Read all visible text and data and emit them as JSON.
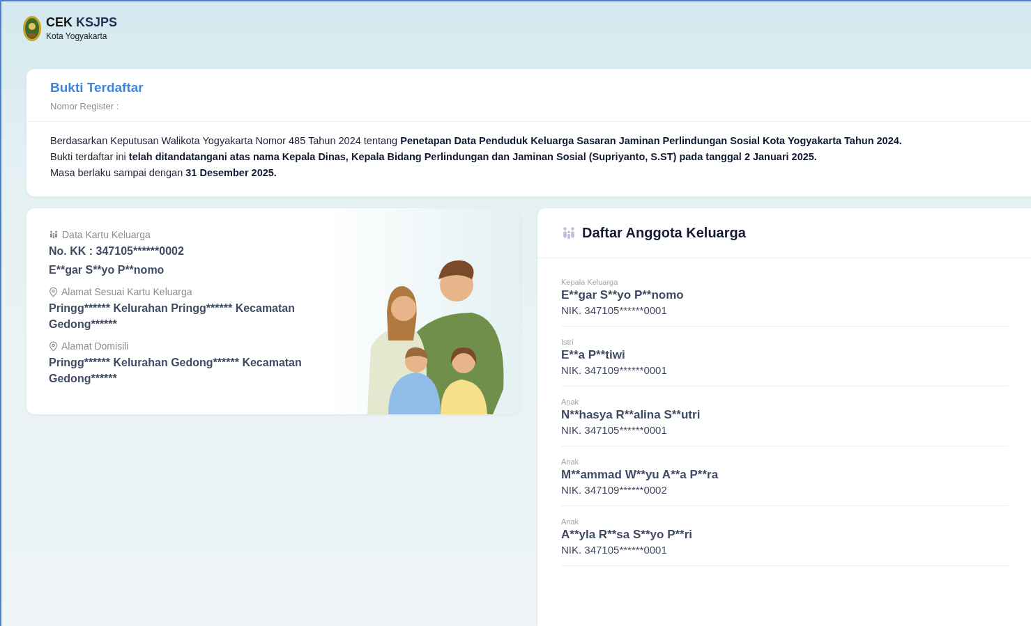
{
  "header": {
    "title_primary": "CEK",
    "title_secondary": "KSJPS",
    "subtitle": "Kota Yogyakarta"
  },
  "proof_card": {
    "title": "Bukti Terdaftar",
    "register_label": "Nomor Register :",
    "lines": [
      "Berdasarkan Keputusan Walikota Yogyakarta Nomor 485 Tahun 2024 tentang **Penetapan Data Penduduk Keluarga Sasaran Jaminan Perlindungan Sosial Kota Yogyakarta Tahun 2024.**",
      "Bukti terdaftar ini **telah ditandatangani atas nama Kepala Dinas, Kepala Bidang Perlindungan dan Jaminan Sosial (Supriyanto, S.ST) pada tanggal 2 Januari 2025.**",
      "Masa berlaku sampai dengan **31 Desember 2025.**"
    ]
  },
  "family_card": {
    "sections": [
      {
        "kind": "family",
        "label": "Data Kartu Keluarga",
        "values": [
          "No. KK : 347105******0002",
          "E**gar S**yo P**nomo"
        ]
      },
      {
        "kind": "location",
        "label": "Alamat Sesuai Kartu Keluarga",
        "values": [
          "Pringg****** Kelurahan Pringg****** Kecamatan Gedong******"
        ]
      },
      {
        "kind": "location",
        "label": "Alamat Domisili",
        "values": [
          "Pringg****** Kelurahan Gedong****** Kecamatan Gedong******"
        ]
      }
    ]
  },
  "members_card": {
    "title": "Daftar Anggota Keluarga",
    "members": [
      {
        "role": "Kepala Keluarga",
        "name": "E**gar S**yo P**nomo",
        "nik": "NIK. 347105******0001"
      },
      {
        "role": "Istri",
        "name": "E**a P**tiwi",
        "nik": "NIK. 347109******0001"
      },
      {
        "role": "Anak",
        "name": "N**hasya R**alina S**utri",
        "nik": "NIK. 347105******0001"
      },
      {
        "role": "Anak",
        "name": "M**ammad W**yu A**a P**ra",
        "nik": "NIK. 347109******0002"
      },
      {
        "role": "Anak",
        "name": "A**yla R**sa S**yo P**ri",
        "nik": "NIK. 347105******0001"
      }
    ]
  }
}
